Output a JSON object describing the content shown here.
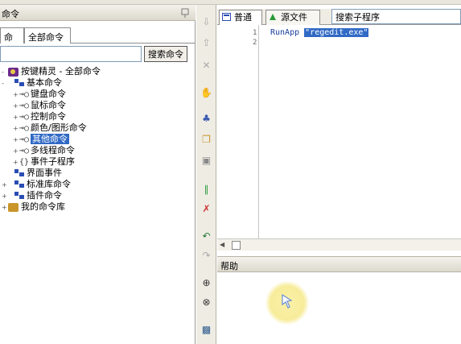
{
  "left_panel": {
    "title": "命令",
    "tabs": [
      "命令",
      "全部命令"
    ],
    "search_value": "",
    "search_button": "搜索命令"
  },
  "tree": [
    {
      "label": "按键精灵 - 全部命令",
      "icon": "root-icon",
      "level": 0,
      "expander": "-"
    },
    {
      "label": "基本命令",
      "icon": "group-icon",
      "level": 1,
      "expander": "-"
    },
    {
      "label": "键盘命令",
      "icon": "leaf-icon",
      "level": 2,
      "expander": "+"
    },
    {
      "label": "鼠标命令",
      "icon": "leaf-icon",
      "level": 2,
      "expander": "+"
    },
    {
      "label": "控制命令",
      "icon": "leaf-icon",
      "level": 2,
      "expander": "+"
    },
    {
      "label": "颜色/图形命令",
      "icon": "leaf-icon",
      "level": 2,
      "expander": "+"
    },
    {
      "label": "其他命令",
      "icon": "leaf-icon",
      "level": 2,
      "expander": "+",
      "selected": true
    },
    {
      "label": "多线程命令",
      "icon": "leaf-icon",
      "level": 2,
      "expander": "+"
    },
    {
      "label": "事件子程序",
      "icon": "brace-icon",
      "level": 2,
      "expander": "+"
    },
    {
      "label": "界面事件",
      "icon": "group-icon",
      "level": 1,
      "expander": ""
    },
    {
      "label": "标准库命令",
      "icon": "group-icon",
      "level": 1,
      "expander": "+"
    },
    {
      "label": "插件命令",
      "icon": "group-icon",
      "level": 1,
      "expander": "+"
    },
    {
      "label": "我的命令库",
      "icon": "library-icon",
      "level": 1,
      "expander": "+"
    }
  ],
  "editor": {
    "tabs": [
      {
        "label": "普通",
        "icon": "normal-view-icon"
      },
      {
        "label": "源文件",
        "icon": "source-file-icon"
      }
    ],
    "sub_search_value": "搜索子程序",
    "line_numbers": [
      "1",
      "2"
    ],
    "code_keyword": "RunApp",
    "code_string": "\"regedit.exe\""
  },
  "help": {
    "title": "帮助"
  },
  "toolbar_icons": [
    "arrow-down-icon",
    "arrow-up-icon",
    "delete-icon",
    "hand-icon",
    "paint-icon",
    "copy-icon",
    "paste-icon",
    "link-icon",
    "unlink-icon",
    "undo-icon",
    "redo-icon",
    "find-icon",
    "find-next-icon",
    "image-icon"
  ],
  "colors": {
    "selection": "#316ac5",
    "keyword": "#1a3fa0",
    "cursor_highlight": "#f7ec9a"
  }
}
